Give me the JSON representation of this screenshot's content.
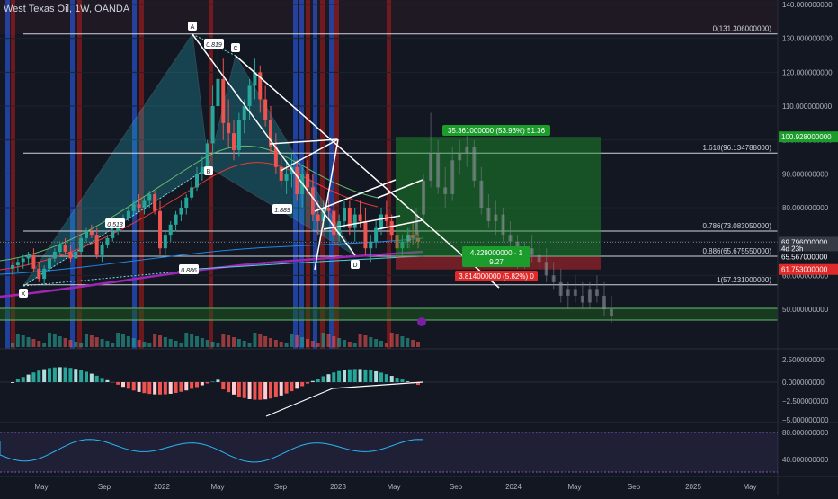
{
  "header": {
    "title": "West Texas Oil, 1W, OANDA"
  },
  "colors": {
    "bg": "#131722",
    "grid": "#1e222d",
    "up": "#26a69a",
    "down": "#ef5350",
    "text": "#b2b5be",
    "fib": "#d1d4dc",
    "target": "#1b9c2b",
    "stop": "#e02a2a",
    "bluebar": "#2962ff",
    "redbar": "#b71c1c"
  },
  "chart_data": [
    {
      "type": "candlestick",
      "title": "West Texas Oil, 1W, OANDA",
      "price_axis": {
        "ylim": [
          45,
          140
        ],
        "ticks": [
          50,
          60,
          70,
          80,
          90,
          100,
          110,
          120,
          130,
          140
        ],
        "labels": [
          "50.000000000",
          "60.000000000",
          "70.000000000",
          "80.000000000",
          "90.000000000",
          "100.000000000",
          "110.000000000",
          "120.000000000",
          "130.000000000",
          "140.000000000"
        ]
      },
      "time_axis": {
        "labels": [
          "May",
          "Sep",
          "2022",
          "May",
          "Sep",
          "2023",
          "May",
          "Sep",
          "2024",
          "May",
          "Sep",
          "2025",
          "May"
        ]
      },
      "fib_levels": [
        {
          "label": "0(131.306000000)",
          "value": 131.306
        },
        {
          "label": "1.618(96.134788000)",
          "value": 96.134788
        },
        {
          "label": "0.786(73.083050000)",
          "value": 73.08305
        },
        {
          "label": "0.886(65.675550000)",
          "value": 65.67555
        },
        {
          "label": "1(57.231000000)",
          "value": 57.231
        }
      ],
      "pattern_points": [
        {
          "label": "X",
          "value": 56.0
        },
        {
          "label": "A",
          "value": 131.3
        },
        {
          "label": "B",
          "value": 92.0
        },
        {
          "label": "C",
          "value": 124.0
        },
        {
          "label": "D",
          "value": 64.0
        }
      ],
      "pattern_ratios": [
        "0.819",
        "0.513",
        "1.889",
        "0.886"
      ],
      "trade": {
        "target_label": "35.361000000 (53.93%) 51.36",
        "entry_label_1": "4.229000000 · 1",
        "entry_label_2": "9.27",
        "stop_label": "3.814000000 (5.82%) 0",
        "target": 100.928,
        "entry": 65.567,
        "stop": 61.753
      },
      "price_badges": [
        {
          "text": "100.928000000",
          "value": 100.928,
          "color": "#1b9c2b"
        },
        {
          "text": "69.796000000",
          "value": 69.796,
          "color": "#363a45"
        },
        {
          "text": "4d 23h",
          "value": 67.9,
          "color": "#363a45"
        },
        {
          "text": "65.567000000",
          "value": 65.567,
          "color": "#131722"
        },
        {
          "text": "61.753000000",
          "value": 61.753,
          "color": "#e02a2a"
        }
      ],
      "candles": [
        [
          62,
          64,
          60,
          63
        ],
        [
          63,
          65,
          61,
          64
        ],
        [
          64,
          66,
          62,
          65
        ],
        [
          65,
          67,
          63,
          66
        ],
        [
          66,
          68,
          61,
          62
        ],
        [
          62,
          64,
          58,
          59
        ],
        [
          59,
          63,
          57,
          62
        ],
        [
          62,
          66,
          61,
          65
        ],
        [
          65,
          68,
          64,
          67
        ],
        [
          67,
          70,
          66,
          69
        ],
        [
          69,
          71,
          66,
          67
        ],
        [
          67,
          69,
          64,
          65
        ],
        [
          65,
          68,
          63,
          67
        ],
        [
          67,
          72,
          66,
          71
        ],
        [
          71,
          74,
          70,
          73
        ],
        [
          73,
          75,
          71,
          72
        ],
        [
          72,
          74,
          65,
          66
        ],
        [
          66,
          70,
          64,
          69
        ],
        [
          69,
          72,
          68,
          71
        ],
        [
          71,
          74,
          70,
          73
        ],
        [
          73,
          76,
          72,
          75
        ],
        [
          75,
          78,
          74,
          77
        ],
        [
          77,
          80,
          76,
          79
        ],
        [
          79,
          82,
          78,
          81
        ],
        [
          81,
          84,
          79,
          80
        ],
        [
          80,
          83,
          78,
          82
        ],
        [
          82,
          85,
          80,
          84
        ],
        [
          84,
          85,
          78,
          79
        ],
        [
          79,
          82,
          66,
          68
        ],
        [
          68,
          73,
          66,
          72
        ],
        [
          72,
          76,
          70,
          75
        ],
        [
          75,
          79,
          73,
          78
        ],
        [
          78,
          82,
          76,
          80
        ],
        [
          80,
          84,
          78,
          83
        ],
        [
          83,
          88,
          82,
          86
        ],
        [
          86,
          92,
          85,
          90
        ],
        [
          90,
          95,
          88,
          92
        ],
        [
          92,
          100,
          90,
          99
        ],
        [
          99,
          116,
          96,
          110
        ],
        [
          110,
          130,
          104,
          118
        ],
        [
          118,
          124,
          100,
          105
        ],
        [
          105,
          112,
          98,
          102
        ],
        [
          102,
          106,
          94,
          97
        ],
        [
          97,
          108,
          95,
          106
        ],
        [
          106,
          112,
          102,
          110
        ],
        [
          110,
          118,
          106,
          116
        ],
        [
          116,
          124,
          112,
          120
        ],
        [
          120,
          122,
          108,
          112
        ],
        [
          112,
          116,
          104,
          106
        ],
        [
          106,
          110,
          96,
          98
        ],
        [
          98,
          102,
          90,
          92
        ],
        [
          92,
          96,
          86,
          88
        ],
        [
          88,
          94,
          84,
          90
        ],
        [
          90,
          96,
          86,
          92
        ],
        [
          92,
          94,
          82,
          84
        ],
        [
          84,
          92,
          80,
          90
        ],
        [
          90,
          94,
          84,
          86
        ],
        [
          86,
          90,
          76,
          78
        ],
        [
          78,
          82,
          72,
          76
        ],
        [
          76,
          82,
          74,
          80
        ],
        [
          80,
          84,
          76,
          79
        ],
        [
          79,
          82,
          70,
          72
        ],
        [
          72,
          78,
          70,
          76
        ],
        [
          76,
          82,
          74,
          80
        ],
        [
          80,
          82,
          72,
          74
        ],
        [
          74,
          80,
          70,
          78
        ],
        [
          78,
          82,
          74,
          76
        ],
        [
          76,
          80,
          66,
          68
        ],
        [
          68,
          72,
          64,
          70
        ],
        [
          70,
          76,
          68,
          74
        ],
        [
          74,
          80,
          72,
          78
        ],
        [
          78,
          82,
          74,
          76
        ],
        [
          76,
          78,
          70,
          72
        ],
        [
          72,
          74,
          66,
          68
        ],
        [
          68,
          72,
          66,
          70
        ],
        [
          70,
          74,
          68,
          72
        ],
        [
          72,
          76,
          69,
          71
        ],
        [
          71,
          73,
          68,
          70
        ]
      ],
      "future_candles": [
        [
          70,
          74,
          68,
          72
        ],
        [
          72,
          80,
          70,
          78
        ],
        [
          78,
          90,
          76,
          88
        ],
        [
          88,
          108,
          86,
          96
        ],
        [
          96,
          100,
          84,
          86
        ],
        [
          86,
          92,
          80,
          84
        ],
        [
          84,
          98,
          82,
          94
        ],
        [
          94,
          100,
          90,
          96
        ],
        [
          96,
          102,
          92,
          98
        ],
        [
          98,
          100,
          86,
          88
        ],
        [
          88,
          92,
          78,
          80
        ],
        [
          80,
          84,
          74,
          76
        ],
        [
          76,
          82,
          72,
          78
        ],
        [
          78,
          80,
          70,
          72
        ],
        [
          72,
          76,
          68,
          70
        ],
        [
          70,
          72,
          62,
          64
        ],
        [
          64,
          70,
          62,
          68
        ],
        [
          68,
          72,
          64,
          66
        ],
        [
          66,
          70,
          62,
          64
        ],
        [
          64,
          68,
          58,
          60
        ],
        [
          60,
          64,
          56,
          58
        ],
        [
          58,
          62,
          52,
          54
        ],
        [
          54,
          58,
          50,
          56
        ],
        [
          56,
          60,
          52,
          54
        ],
        [
          54,
          58,
          50,
          52
        ],
        [
          52,
          58,
          50,
          56
        ],
        [
          56,
          60,
          52,
          54
        ],
        [
          54,
          58,
          48,
          50
        ],
        [
          50,
          54,
          46,
          48
        ]
      ],
      "histogram_panel": {
        "ticks": [
          "2.500000000",
          "0.000000000",
          "−2.500000000",
          "−5.000000000"
        ]
      },
      "oscillator_panel": {
        "ticks": [
          "80.000000000",
          "40.000000000"
        ]
      }
    }
  ]
}
